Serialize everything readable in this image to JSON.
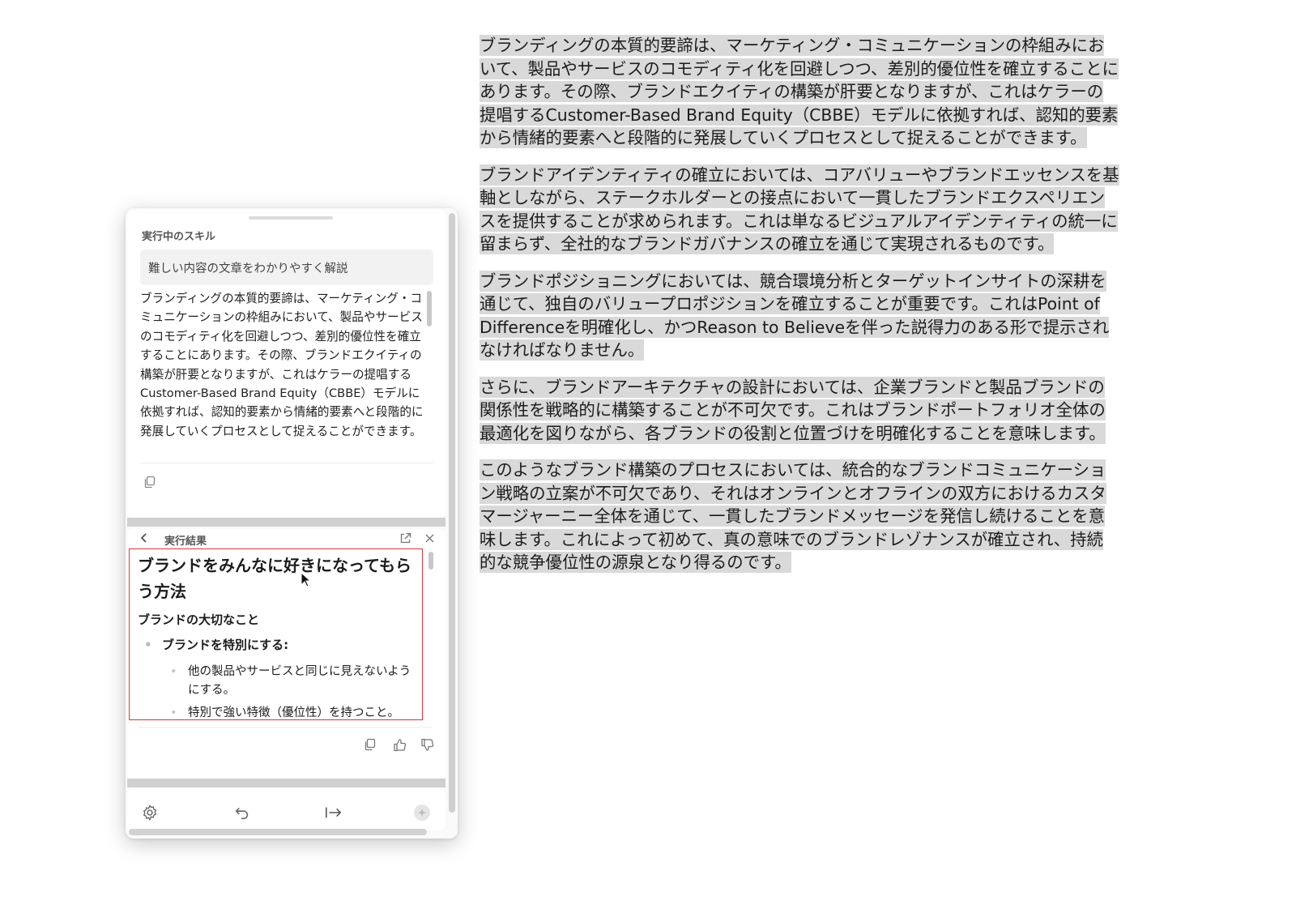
{
  "document": {
    "paragraphs": [
      "ブランディングの本質的要諦は、マーケティング・コミュニケーションの枠組みにおいて、製品やサービスのコモディティ化を回避しつつ、差別的優位性を確立することにあります。その際、ブランドエクイティの構築が肝要となりますが、これはケラーの提唱するCustomer-Based Brand Equity（CBBE）モデルに依拠すれば、認知的要素から情緒的要素へと段階的に発展していくプロセスとして捉えることができます。",
      "ブランドアイデンティティの確立においては、コアバリューやブランドエッセンスを基軸としながら、ステークホルダーとの接点において一貫したブランドエクスペリエンスを提供することが求められます。これは単なるビジュアルアイデンティティの統一に留まらず、全社的なブランドガバナンスの確立を通じて実現されるものです。",
      "ブランドポジショニングにおいては、競合環境分析とターゲットインサイトの深耕を通じて、独自のバリュープロポジションを確立することが重要です。これはPoint of Differenceを明確化し、かつReason to Believeを伴った説得力のある形で提示されなければなりません。",
      "さらに、ブランドアーキテクチャの設計においては、企業ブランドと製品ブランドの関係性を戦略的に構築することが不可欠です。これはブランドポートフォリオ全体の最適化を図りながら、各ブランドの役割と位置づけを明確化することを意味します。",
      "このようなブランド構築のプロセスにおいては、統合的なブランドコミュニケーション戦略の立案が不可欠であり、それはオンラインとオフラインの双方におけるカスタマージャーニー全体を通じて、一貫したブランドメッセージを発信し続けることを意味します。これによって初めて、真の意味でのブランドレゾナンスが確立され、持続的な競争優位性の源泉となり得るのです。"
    ]
  },
  "panel": {
    "skill_section_label": "実行中のスキル",
    "skill_name": "難しい内容の文章をわかりやすく解説",
    "skill_input": "ブランディングの本質的要諦は、マーケティング・コミュニケーションの枠組みにおいて、製品やサービスのコモディティ化を回避しつつ、差別的優位性を確立することにあります。その際、ブランドエクイティの構築が肝要となりますが、これはケラーの提唱するCustomer-Based Brand Equity（CBBE）モデルに依拠すれば、認知的要素から情緒的要素へと段階的に発展していくプロセスとして捉えることができます。",
    "result_section_label": "実行結果",
    "result": {
      "title": "ブランドをみんなに好きになってもらう方法",
      "heading": "ブランドの大切なこと",
      "item1": "ブランドを特別にする:",
      "sub1": "他の製品やサービスと同じに見えないようにする。",
      "sub2": "特別で強い特徴（優位性）を持つこと。"
    }
  },
  "icons": {
    "copy": "copy-icon",
    "back": "chevron-left-icon",
    "external": "external-link-icon",
    "close": "close-icon",
    "thumb_up": "thumbs-up-icon",
    "thumb_down": "thumbs-down-icon",
    "settings": "gear-icon",
    "undo": "undo-icon",
    "insert": "arrow-right-to-line-icon",
    "assistant": "sparkle-icon"
  },
  "colors": {
    "highlight": "#d9d9d9",
    "result_border": "#d9363e"
  }
}
